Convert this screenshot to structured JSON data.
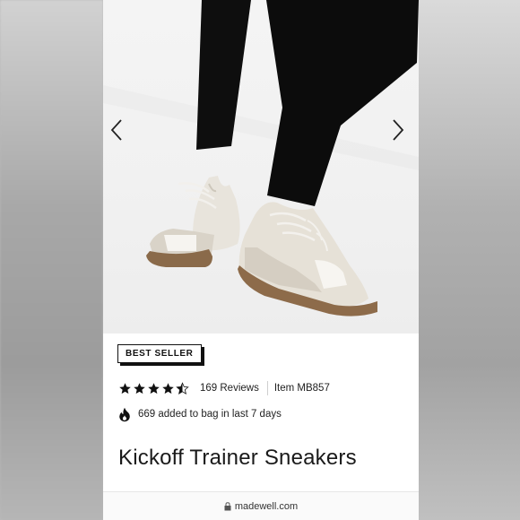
{
  "hero": {
    "prev_icon": "chevron-left-icon",
    "next_icon": "chevron-right-icon"
  },
  "product": {
    "badge": "BEST SELLER",
    "rating": {
      "value": 4.5,
      "max": 5
    },
    "reviews": "169 Reviews",
    "item_number": "Item MB857",
    "activity": "669 added to bag in last 7 days",
    "title": "Kickoff Trainer Sneakers"
  },
  "browser": {
    "url": "madewell.com",
    "lock_icon": "lock-icon"
  }
}
